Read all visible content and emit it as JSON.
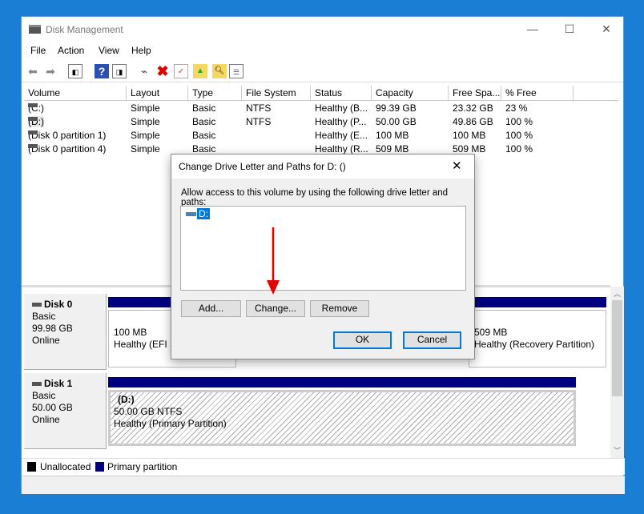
{
  "window": {
    "title": "Disk Management",
    "minimize": "—",
    "maximize": "☐",
    "close": "✕"
  },
  "menu": [
    "File",
    "Action",
    "View",
    "Help"
  ],
  "toolbar": [
    "back-icon",
    "forward-icon",
    "console-tree-icon",
    "help-icon",
    "action-pane-icon",
    "connect-drive-icon",
    "delete-icon",
    "properties-icon",
    "open-folder-icon",
    "explore-icon",
    "settings-list-icon"
  ],
  "table": {
    "columns": [
      "Volume",
      "Layout",
      "Type",
      "File System",
      "Status",
      "Capacity",
      "Free Spa...",
      "% Free"
    ],
    "rows": [
      [
        "(C:)",
        "Simple",
        "Basic",
        "NTFS",
        "Healthy (B...",
        "99.39 GB",
        "23.32 GB",
        "23 %"
      ],
      [
        "(D:)",
        "Simple",
        "Basic",
        "NTFS",
        "Healthy (P...",
        "50.00 GB",
        "49.86 GB",
        "100 %"
      ],
      [
        "(Disk 0 partition 1)",
        "Simple",
        "Basic",
        "",
        "Healthy (E...",
        "100 MB",
        "100 MB",
        "100 %"
      ],
      [
        "(Disk 0 partition 4)",
        "Simple",
        "Basic",
        "",
        "Healthy (R...",
        "509 MB",
        "509 MB",
        "100 %"
      ]
    ]
  },
  "disks": [
    {
      "name": "Disk 0",
      "type": "Basic",
      "size": "99.98 GB",
      "state": "Online",
      "p1": {
        "size": "100 MB",
        "status": "Healthy (EFI S"
      },
      "p4": {
        "size": "509 MB",
        "status": "Healthy (Recovery Partition)"
      }
    },
    {
      "name": "Disk 1",
      "type": "Basic",
      "size": "50.00 GB",
      "state": "Online",
      "p1": {
        "label": "(D:)",
        "size": "50.00 GB NTFS",
        "status": "Healthy (Primary Partition)"
      }
    }
  ],
  "legend": {
    "unallocated": "Unallocated",
    "primary": "Primary partition",
    "colors": {
      "unallocated": "#000000",
      "primary": "#000080"
    }
  },
  "dialog": {
    "title": "Change Drive Letter and Paths for D: ()",
    "close": "✕",
    "instruction": "Allow access to this volume by using the following drive letter and paths:",
    "paths": [
      "D:"
    ],
    "add": "Add...",
    "change": "Change...",
    "remove": "Remove",
    "ok": "OK",
    "cancel": "Cancel"
  },
  "annotation": {
    "arrow_color": "#e00000"
  }
}
